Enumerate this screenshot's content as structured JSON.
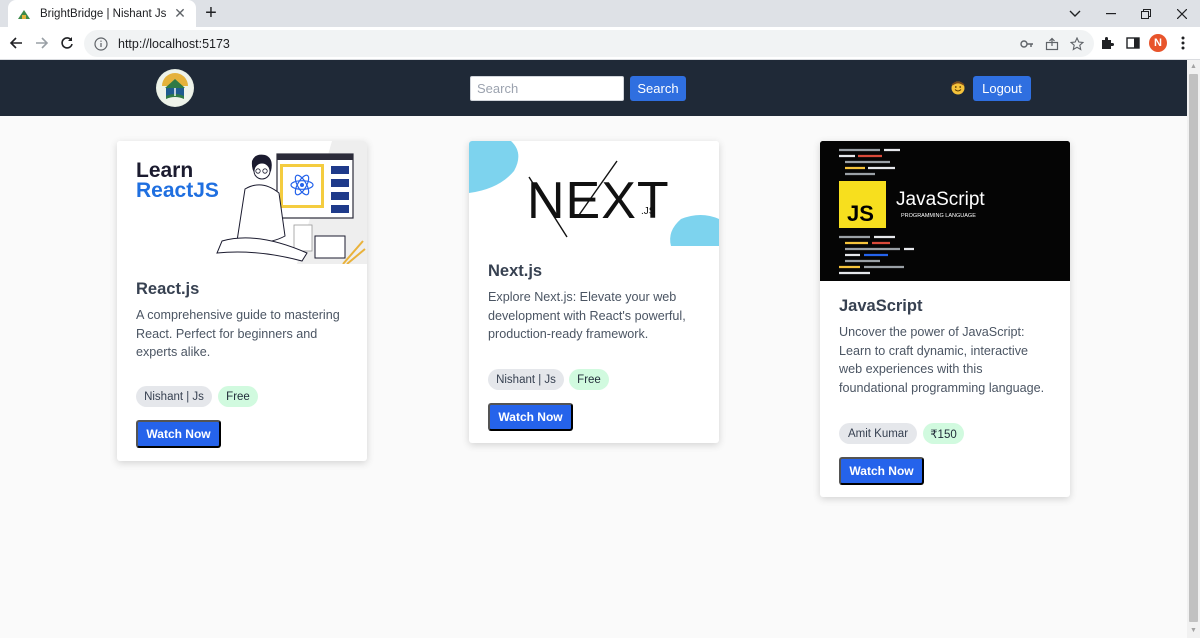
{
  "browser": {
    "tab_title": "BrightBridge | Nishant Js",
    "url": "http://localhost:5173",
    "profile_initial": "N"
  },
  "navbar": {
    "search_placeholder": "Search",
    "search_button": "Search",
    "logout_button": "Logout"
  },
  "courses": [
    {
      "title": "React.js",
      "description": "A comprehensive guide to mastering React. Perfect for beginners and experts alike.",
      "author": "Nishant | Js",
      "price": "Free",
      "button": "Watch Now",
      "thumb_text": [
        "Learn",
        "ReactJS"
      ]
    },
    {
      "title": "Next.js",
      "description": "Explore Next.js: Elevate your web development with React's powerful, production-ready framework.",
      "author": "Nishant | Js",
      "price": "Free",
      "button": "Watch Now",
      "thumb_text": [
        "NEXT",
        ".JS"
      ]
    },
    {
      "title": "JavaScript",
      "description": "Uncover the power of JavaScript: Learn to craft dynamic, interactive web experiences with this foundational programming language.",
      "author": "Amit Kumar",
      "price": "₹150",
      "button": "Watch Now",
      "thumb_text": [
        "JS",
        "JavaScript",
        "PROGRAMMING LANGUAGE"
      ]
    }
  ],
  "colors": {
    "navbar_bg": "#1f2937",
    "accent_blue": "#2563eb",
    "price_pill": "#d1fadf"
  }
}
